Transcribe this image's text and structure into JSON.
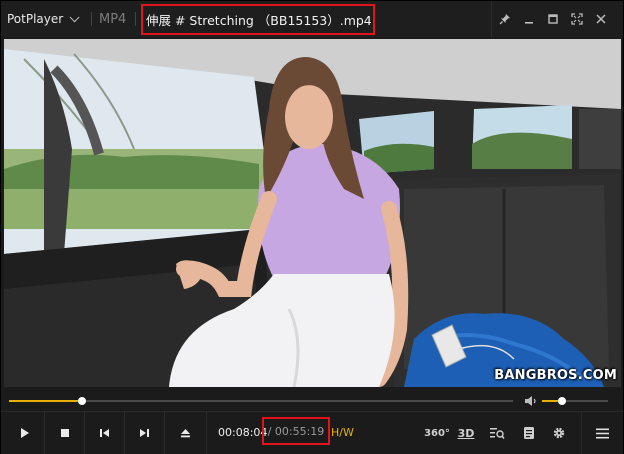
{
  "app": {
    "name": "PotPlayer",
    "format": "MP4",
    "filename": "伸展 # Stretching （BB15153）.mp4"
  },
  "window_buttons": [
    "pin-icon",
    "minimize-icon",
    "restore-icon",
    "fullscreen-icon",
    "close-icon"
  ],
  "video": {
    "watermark": "BANGBROS.COM"
  },
  "seek": {
    "progress_fraction": 0.145
  },
  "volume": {
    "level_fraction": 0.3
  },
  "controls": {
    "buttons": [
      "play-icon",
      "stop-icon",
      "previous-icon",
      "next-icon",
      "eject-icon"
    ],
    "current_time": "00:08:04",
    "total_time": "/ 00:55:19",
    "decoder": "H/W",
    "right_icons": {
      "vr360": "360°",
      "stereo3d": "3D"
    }
  },
  "colors": {
    "accent": "#e8b000",
    "highlight_box": "#e1141b"
  }
}
